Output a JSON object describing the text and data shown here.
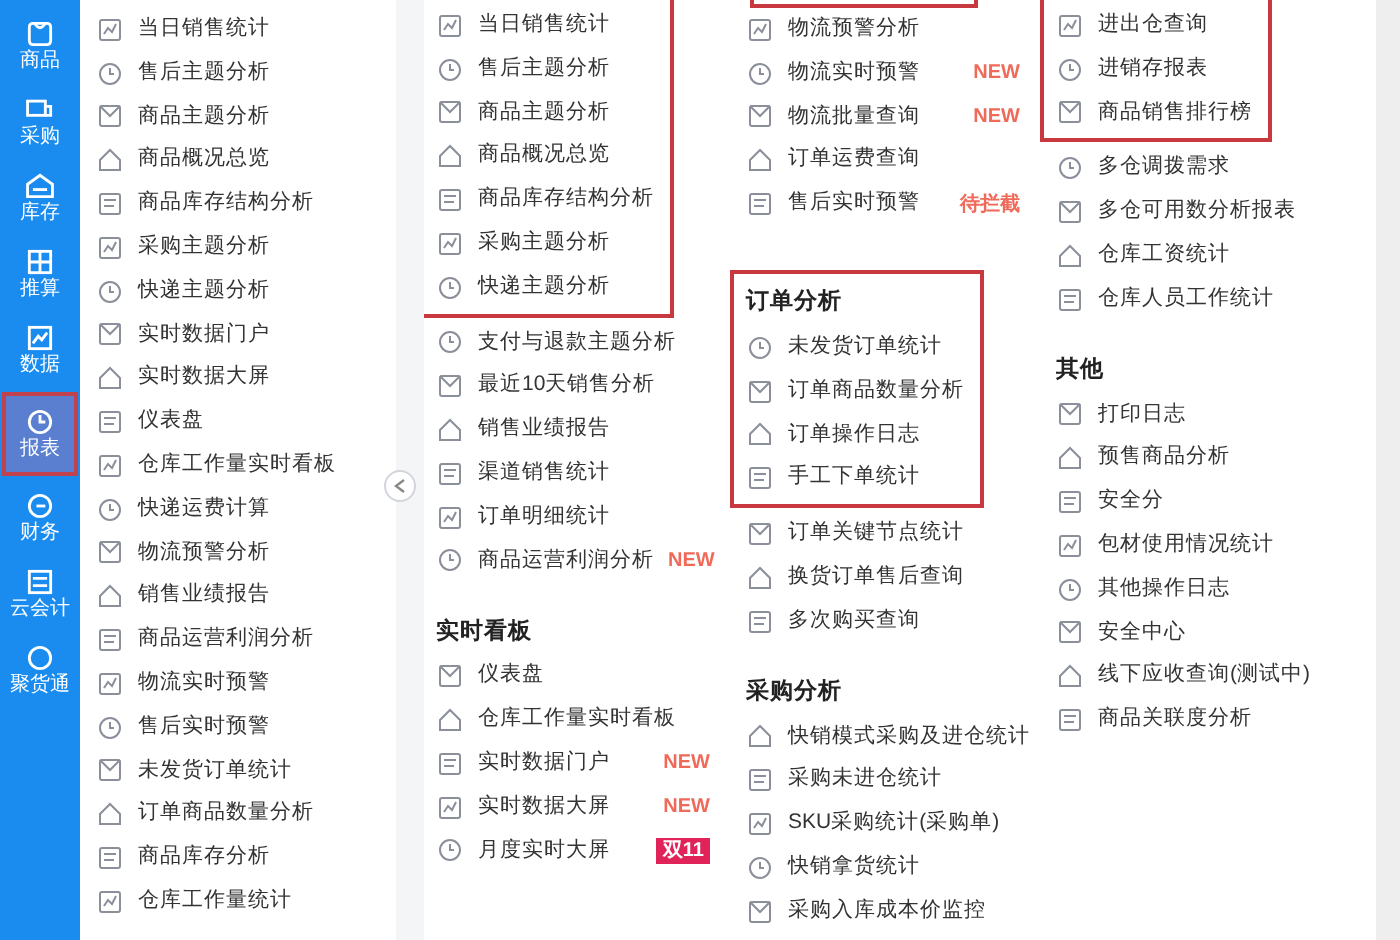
{
  "sidebar": {
    "items": [
      {
        "label": "商品",
        "selected": false
      },
      {
        "label": "采购",
        "selected": false
      },
      {
        "label": "库存",
        "selected": false
      },
      {
        "label": "推算",
        "selected": false
      },
      {
        "label": "数据",
        "selected": false
      },
      {
        "label": "报表",
        "selected": true
      },
      {
        "label": "财务",
        "selected": false
      },
      {
        "label": "云会计",
        "selected": false
      },
      {
        "label": "聚货通",
        "selected": false
      }
    ]
  },
  "favorites": {
    "items": [
      "当日销售统计",
      "售后主题分析",
      "商品主题分析",
      "商品概况总览",
      "商品库存结构分析",
      "采购主题分析",
      "快递主题分析",
      "实时数据门户",
      "实时数据大屏",
      "仪表盘",
      "仓库工作量实时看板",
      "快递运费计算",
      "物流预警分析",
      "销售业绩报告",
      "商品运营利润分析",
      "物流实时预警",
      "售后实时预警",
      "未发货订单统计",
      "订单商品数量分析",
      "商品库存分析",
      "仓库工作量统计"
    ]
  },
  "columns": [
    {
      "sections": [
        {
          "highlighted": true,
          "items": [
            {
              "label": "当日销售统计"
            },
            {
              "label": "售后主题分析"
            },
            {
              "label": "商品主题分析"
            },
            {
              "label": "商品概况总览"
            },
            {
              "label": "商品库存结构分析"
            },
            {
              "label": "采购主题分析"
            },
            {
              "label": "快递主题分析"
            }
          ]
        },
        {
          "highlighted": false,
          "items": [
            {
              "label": "支付与退款主题分析"
            },
            {
              "label": "最近10天销售分析"
            },
            {
              "label": "销售业绩报告"
            },
            {
              "label": "渠道销售统计"
            },
            {
              "label": "订单明细统计"
            },
            {
              "label": "商品运营利润分析",
              "badge": {
                "text": "NEW",
                "kind": "text"
              }
            }
          ]
        },
        {
          "heading": "实时看板",
          "highlighted": false,
          "items": [
            {
              "label": "仪表盘"
            },
            {
              "label": "仓库工作量实时看板"
            },
            {
              "label": "实时数据门户",
              "badge": {
                "text": "NEW",
                "kind": "text"
              }
            },
            {
              "label": "实时数据大屏",
              "badge": {
                "text": "NEW",
                "kind": "text"
              }
            },
            {
              "label": "月度实时大屏",
              "badge": {
                "text": "双11",
                "kind": "filled"
              }
            }
          ]
        }
      ]
    },
    {
      "sections": [
        {
          "highlighted": false,
          "items": [
            {
              "label": "物流预警分析"
            },
            {
              "label": "物流实时预警",
              "badge": {
                "text": "NEW",
                "kind": "text"
              }
            },
            {
              "label": "物流批量查询",
              "badge": {
                "text": "NEW",
                "kind": "text"
              }
            },
            {
              "label": "订单运费查询"
            },
            {
              "label": "售后实时预警",
              "badge": {
                "text": "待拦截",
                "kind": "text"
              }
            }
          ]
        },
        {
          "heading": "订单分析",
          "highlighted": true,
          "items": [
            {
              "label": "未发货订单统计"
            },
            {
              "label": "订单商品数量分析"
            },
            {
              "label": "订单操作日志"
            },
            {
              "label": "手工下单统计"
            }
          ]
        },
        {
          "highlighted": false,
          "items": [
            {
              "label": "订单关键节点统计"
            },
            {
              "label": "换货订单售后查询"
            },
            {
              "label": "多次购买查询"
            }
          ]
        },
        {
          "heading": "采购分析",
          "highlighted": false,
          "items": [
            {
              "label": "快销模式采购及进仓统计"
            },
            {
              "label": "采购未进仓统计"
            },
            {
              "label": "SKU采购统计(采购单)"
            },
            {
              "label": "快销拿货统计"
            },
            {
              "label": "采购入库成本价监控"
            }
          ]
        }
      ]
    },
    {
      "sections": [
        {
          "highlighted": true,
          "items": [
            {
              "label": "进出仓查询"
            },
            {
              "label": "进销存报表"
            },
            {
              "label": "商品销售排行榜"
            }
          ]
        },
        {
          "highlighted": false,
          "items": [
            {
              "label": "多仓调拨需求"
            },
            {
              "label": "多仓可用数分析报表"
            },
            {
              "label": "仓库工资统计"
            },
            {
              "label": "仓库人员工作统计"
            }
          ]
        },
        {
          "heading": "其他",
          "highlighted": false,
          "items": [
            {
              "label": "打印日志"
            },
            {
              "label": "预售商品分析"
            },
            {
              "label": "安全分"
            },
            {
              "label": "包材使用情况统计"
            },
            {
              "label": "其他操作日志"
            },
            {
              "label": "安全中心"
            },
            {
              "label": "线下应收查询(测试中)"
            },
            {
              "label": "商品关联度分析"
            }
          ]
        }
      ]
    }
  ]
}
